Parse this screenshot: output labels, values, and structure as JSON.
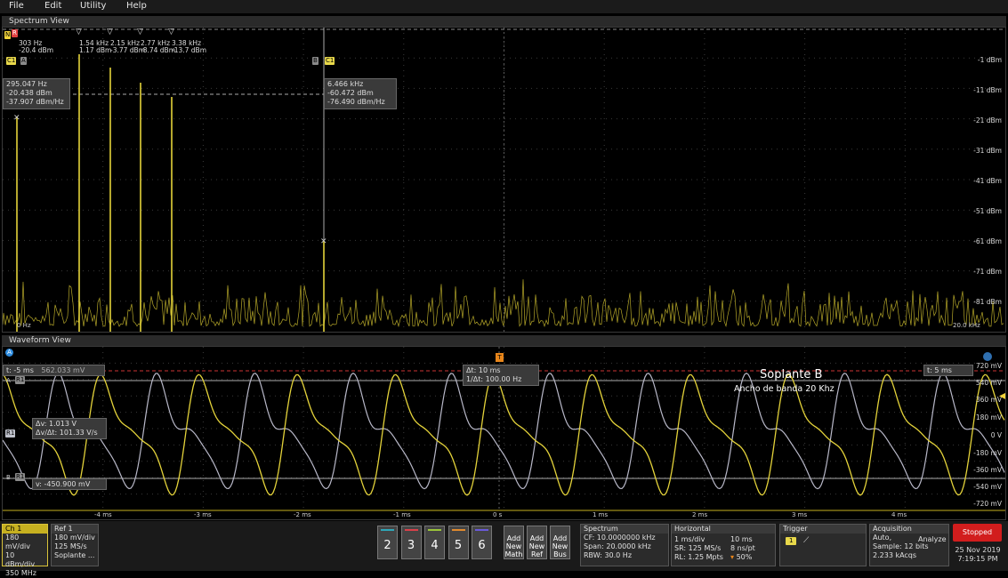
{
  "menu": [
    "File",
    "Edit",
    "Utility",
    "Help"
  ],
  "spectrum": {
    "title": "Spectrum View",
    "y_labels": [
      "-1 dBm",
      "-11 dBm",
      "-21 dBm",
      "-31 dBm",
      "-41 dBm",
      "-51 dBm",
      "-61 dBm",
      "-71 dBm",
      "-81 dBm"
    ],
    "x_start": "0 Hz",
    "x_end": "20.0 kHz",
    "top_marker": {
      "freq": "303 Hz",
      "level": "-20.4 dBm"
    },
    "peaks": [
      {
        "freq": "1.54 kHz",
        "level": "1.17 dBm"
      },
      {
        "freq": "2.15 kHz",
        "level": "-3.77 dBm"
      },
      {
        "freq": "2.77 kHz",
        "level": "-8.74 dBm"
      },
      {
        "freq": "3.38 kHz",
        "level": "-13.7 dBm"
      }
    ],
    "cursor_a": {
      "tag": "C1",
      "label": "A",
      "freq": "295.047 Hz",
      "level": "-20.438 dBm",
      "density": "-37.907 dBm/Hz"
    },
    "cursor_b": {
      "tag": "C1",
      "label": "B",
      "freq": "6.466 kHz",
      "level": "-60.472 dBm",
      "density": "-76.490 dBm/Hz"
    },
    "ref_tag": "R",
    "mark_tag": "N"
  },
  "waveform": {
    "title": "Waveform View",
    "y_labels": [
      "540 mV",
      "360 mV",
      "180 mV",
      "0 V",
      "-180 mV",
      "-360 mV",
      "-540 mV",
      "-720 mV"
    ],
    "top_y_label": "720 mV",
    "x_labels": [
      "-4 ms",
      "-3 ms",
      "-2 ms",
      "-1 ms",
      "0 s",
      "1 ms",
      "2 ms",
      "3 ms",
      "4 ms"
    ],
    "cursor_left": {
      "t": "t: -5 ms",
      "v": "562.033 mV"
    },
    "cursor_right": {
      "t": "t: 5 ms"
    },
    "delta_time": {
      "dt": "Δt: 10 ms",
      "inv": "1/Δt: 100.00 Hz"
    },
    "delta_v": {
      "dv": "Δv: 1.013 V",
      "dvdt": "Δv/Δt: 101.33 V/s"
    },
    "v_readout": "v: -450.900 mV",
    "annotation_title": "Soplante B",
    "annotation_sub": "Ancho de banda 20 Khz",
    "a_badge": "A",
    "r_tag": "R1",
    "a_tag": "A",
    "b_tag": "B",
    "trigger_tag": "T"
  },
  "bottom": {
    "ch1": {
      "title": "Ch 1",
      "lines": [
        "180 mV/div",
        "10 dBm/div",
        "350 MHz"
      ]
    },
    "ref1": {
      "title": "Ref 1",
      "lines": [
        "180 mV/div",
        "125 MS/s",
        "Soplante ..."
      ]
    },
    "channels": [
      "2",
      "3",
      "4",
      "5",
      "6"
    ],
    "channel_colors": [
      "#2fa7b8",
      "#d9414a",
      "#9bc43a",
      "#e08a2e",
      "#6a5ad9"
    ],
    "add_buttons": [
      [
        "Add",
        "New",
        "Math"
      ],
      [
        "Add",
        "New",
        "Ref"
      ],
      [
        "Add",
        "New",
        "Bus"
      ]
    ],
    "spectrum": {
      "title": "Spectrum",
      "lines": [
        "CF: 10.0000000 kHz",
        "Span: 20.0000 kHz",
        "RBW: 30.0 Hz"
      ]
    },
    "horizontal": {
      "title": "Horizontal",
      "left": [
        "1 ms/div",
        "SR: 125 MS/s",
        "RL: 1.25 Mpts"
      ],
      "right": [
        "10 ms",
        "8 ns/pt",
        "50%"
      ]
    },
    "trigger": {
      "title": "Trigger",
      "badge": "1"
    },
    "acquisition": {
      "title": "Acquisition",
      "lines": [
        "Auto,",
        "Sample: 12 bits",
        "2.233 kAcqs"
      ],
      "analyze": "Analyze"
    },
    "stopped": "Stopped",
    "date": "25 Nov 2019",
    "time": "7:19:15 PM"
  },
  "colors": {
    "ch1": "#e3d23a",
    "ref1": "#b8b8c8",
    "stopped": "#d21d1d"
  }
}
